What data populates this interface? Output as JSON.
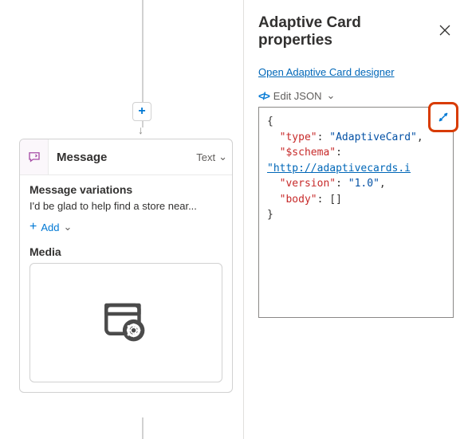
{
  "canvas": {
    "plus": "+",
    "arrow": "↓"
  },
  "node": {
    "title": "Message",
    "typeLabel": "Text",
    "variationsHead": "Message variations",
    "variationPreview": "I'd be glad to help find a store near...",
    "addLabel": "Add",
    "mediaHead": "Media"
  },
  "panel": {
    "title": "Adaptive Card properties",
    "designerLink": "Open Adaptive Card designer",
    "editJsonLabel": "Edit JSON",
    "json": {
      "k_type": "\"type\"",
      "v_type": "\"AdaptiveCard\"",
      "k_schema": "\"$schema\"",
      "v_schema": "\"http://adaptivecards.i",
      "k_version": "\"version\"",
      "v_version": "\"1.0\"",
      "k_body": "\"body\"",
      "v_body": "[]"
    }
  }
}
